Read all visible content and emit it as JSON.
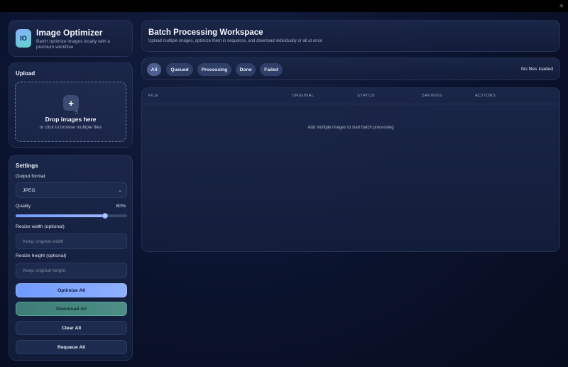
{
  "brand": {
    "logo_text": "IO",
    "title": "Image Optimizer",
    "subtitle": "Batch optimize images locally with a premium workflow"
  },
  "upload": {
    "heading": "Upload",
    "drop_title": "Drop images here",
    "drop_subtitle": "or click to browse multiple files",
    "add_icon": "plus-icon"
  },
  "settings": {
    "heading": "Settings",
    "output_format_label": "Output format",
    "output_format_value": "JPEG",
    "quality_label": "Quality",
    "quality_value": "80%",
    "quality_fraction": 0.8,
    "resize_width_label": "Resize width (optional)",
    "resize_width_placeholder": "Keep original width",
    "resize_height_label": "Resize height (optional)",
    "resize_height_placeholder": "Keep original height",
    "optimize_all": "Optimize All",
    "download_all": "Download All",
    "clear_all": "Clear All",
    "requeue_all": "Requeue All"
  },
  "workspace": {
    "title": "Batch Processing Workspace",
    "subtitle": "Upload multiple images, optimize them in sequence, and download individually or all at once"
  },
  "filters": {
    "chips": [
      "All",
      "Queued",
      "Processing",
      "Done",
      "Failed"
    ],
    "active": "All",
    "files_status": "No files loaded"
  },
  "table": {
    "columns": [
      "FILE",
      "ORIGINAL",
      "STATUS",
      "SAVINGS",
      "ACTIONS"
    ],
    "empty_message": "Add multiple images to start batch processing"
  },
  "colors": {
    "accent": "#6f9bff",
    "teal": "#4d8f85",
    "background": "#0b1430"
  }
}
